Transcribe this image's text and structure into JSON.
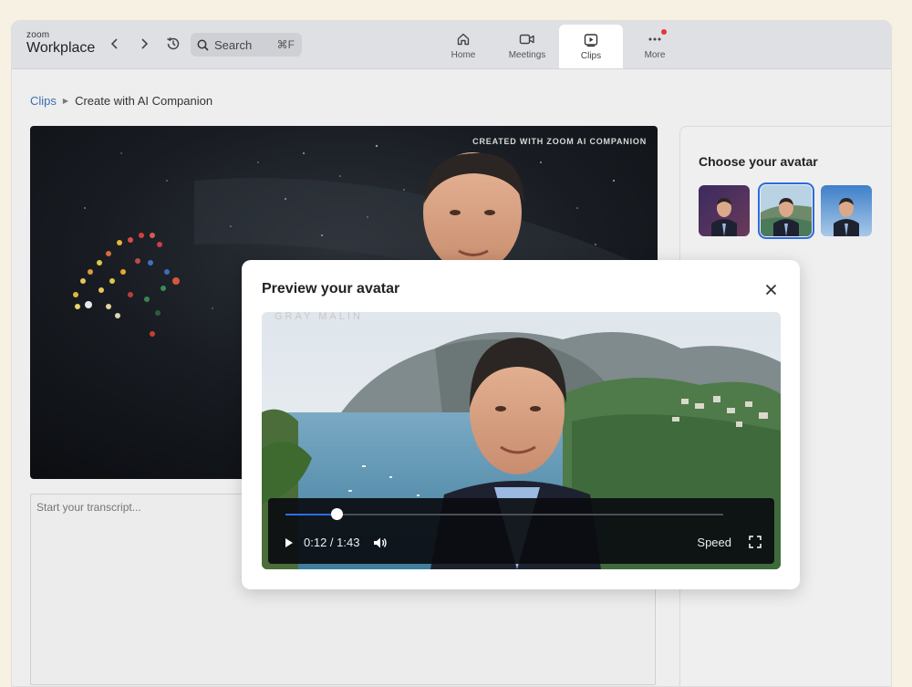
{
  "app": {
    "logo_small": "zoom",
    "logo_big": "Workplace"
  },
  "search": {
    "label": "Search",
    "shortcut": "⌘F"
  },
  "tabs": [
    {
      "label": "Home",
      "icon": "home-icon"
    },
    {
      "label": "Meetings",
      "icon": "video-camera-icon"
    },
    {
      "label": "Clips",
      "icon": "clip-play-icon",
      "active": true
    },
    {
      "label": "More",
      "icon": "more-dots-icon",
      "notification": true
    }
  ],
  "breadcrumb": {
    "parent": "Clips",
    "current": "Create with AI Companion"
  },
  "main_video": {
    "watermark": "CREATED WITH ZOOM AI COMPANION"
  },
  "transcript": {
    "placeholder": "Start your transcript..."
  },
  "avatar_panel": {
    "title": "Choose your avatar",
    "avatars": [
      {
        "name": "avatar-galaxy"
      },
      {
        "name": "avatar-coast",
        "selected": true
      },
      {
        "name": "avatar-sky"
      }
    ]
  },
  "modal": {
    "title": "Preview your avatar",
    "player": {
      "time": "0:12 / 1:43",
      "progress": 0.1165,
      "speed_label": "Speed"
    }
  },
  "colors": {
    "accent": "#2d6de8",
    "link": "#3a6fb0",
    "notification": "#e8333b"
  }
}
